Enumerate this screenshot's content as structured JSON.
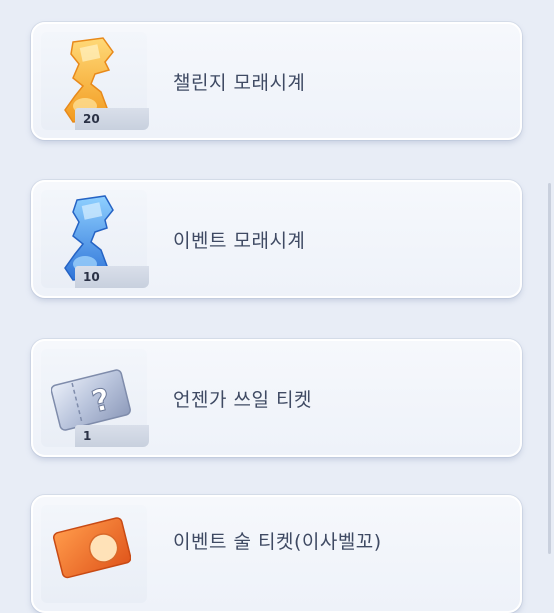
{
  "items": [
    {
      "name": "챌린지 모래시계",
      "count": "20",
      "icon": "gold-hourglass-icon",
      "color": "#f5a623"
    },
    {
      "name": "이벤트 모래시계",
      "count": "10",
      "icon": "blue-hourglass-icon",
      "color": "#3d8de8"
    },
    {
      "name": "언젠가 쓰일 티켓",
      "count": "1",
      "icon": "mystery-ticket-icon",
      "color": "#9aa6c4"
    },
    {
      "name": "이벤트 술 티켓(이사벨꼬)",
      "count": "",
      "icon": "orange-ticket-icon",
      "color": "#f07a2e"
    }
  ]
}
